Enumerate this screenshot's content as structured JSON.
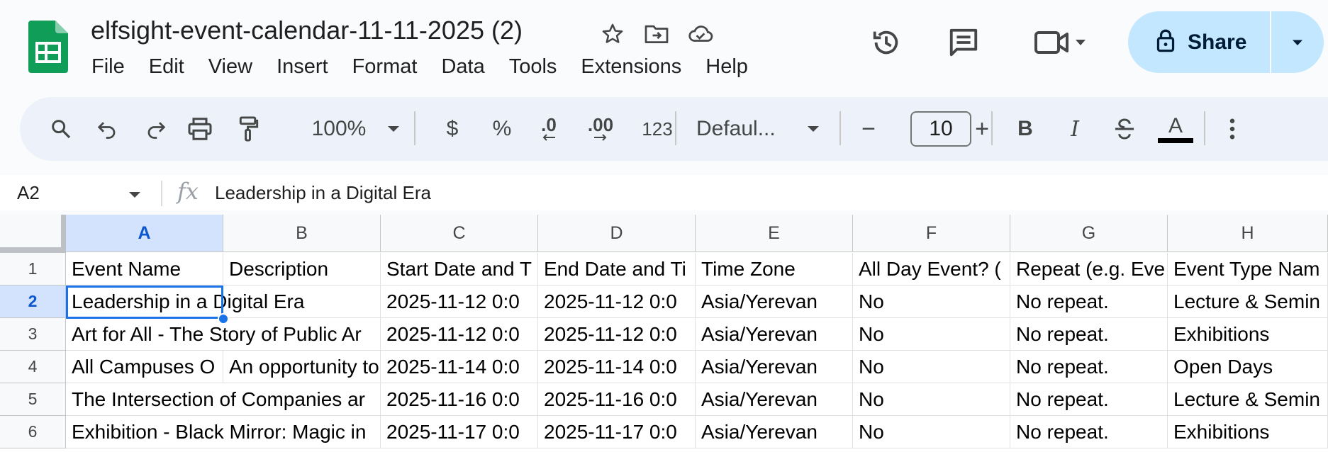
{
  "header": {
    "title": "elfsight-event-calendar-11-11-2025 (2)",
    "title_icons": [
      "star-icon",
      "move-to-folder-icon",
      "cloud-saved-icon"
    ],
    "menus": [
      "File",
      "Edit",
      "View",
      "Insert",
      "Format",
      "Data",
      "Tools",
      "Extensions",
      "Help"
    ],
    "right_icons": [
      "version-history-icon",
      "comments-icon",
      "meet-video-icon"
    ],
    "share_label": "Share"
  },
  "toolbar": {
    "zoom": "100%",
    "currency": "$",
    "percent": "%",
    "decrease_decimal": ".0",
    "increase_decimal": ".00",
    "number_format": "123",
    "font": "Defaul...",
    "font_size": "10",
    "minus": "−",
    "plus": "+",
    "bold": "B",
    "italic": "I",
    "text_color_label": "A",
    "text_color_bar": "#000000"
  },
  "formula_bar": {
    "cell_ref": "A2",
    "fx": "fx",
    "content": "Leadership in a Digital Era"
  },
  "sheet": {
    "columns": [
      "A",
      "B",
      "C",
      "D",
      "E",
      "F",
      "G",
      "H"
    ],
    "selected_column": "A",
    "rows": [
      {
        "num": "1",
        "cells": [
          "Event Name",
          "Description",
          "Start Date and T",
          "End Date and Ti",
          "Time Zone",
          "All Day Event? (",
          "Repeat (e.g. Eve",
          "Event Type Nam"
        ]
      },
      {
        "num": "2",
        "a_text": "Leadership in a Digital Era",
        "cells": [
          "",
          "",
          "2025-11-12 0:0",
          "2025-11-12 0:0",
          "Asia/Yerevan",
          "No",
          "No repeat.",
          "Lecture & Semin"
        ]
      },
      {
        "num": "3",
        "a_text": "Art for All - The Story of Public Ar",
        "cells": [
          "",
          "",
          "2025-11-12 0:0",
          "2025-11-12 0:0",
          "Asia/Yerevan",
          "No",
          "No repeat.",
          "Exhibitions"
        ]
      },
      {
        "num": "4",
        "cells": [
          "All Campuses O",
          "An opportunity to",
          "2025-11-14 0:0",
          "2025-11-14 0:0",
          "Asia/Yerevan",
          "No",
          "No repeat.",
          "Open Days"
        ]
      },
      {
        "num": "5",
        "a_text": "The Intersection of Companies ar",
        "cells": [
          "",
          "",
          "2025-11-16 0:0",
          "2025-11-16 0:0",
          "Asia/Yerevan",
          "No",
          "No repeat.",
          "Lecture & Semin"
        ]
      },
      {
        "num": "6",
        "a_text": "Exhibition - Black Mirror: Magic in",
        "cells": [
          "",
          "",
          "2025-11-17 0:0",
          "2025-11-17 0:0",
          "Asia/Yerevan",
          "No",
          "No repeat.",
          "Exhibitions"
        ]
      }
    ],
    "selected_row": "2",
    "accent": "#1a73e8"
  }
}
